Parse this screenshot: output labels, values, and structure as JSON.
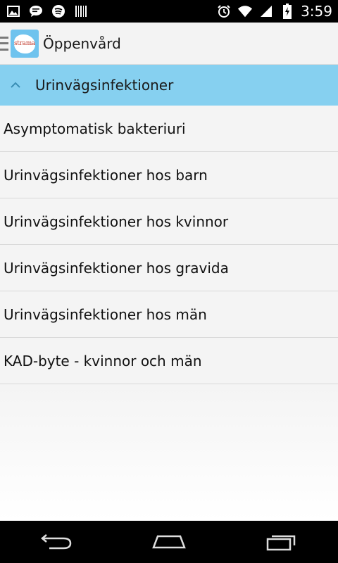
{
  "status_bar": {
    "time": "3:59",
    "left_icons": [
      "image-icon",
      "chat-icon",
      "spotify-icon",
      "barcode-icon"
    ],
    "right_icons": [
      "alarm-icon",
      "wifi-icon",
      "signal-icon",
      "battery-charging-icon"
    ]
  },
  "action_bar": {
    "logo_text": "strama",
    "title": "Öppenvård"
  },
  "group": {
    "label": "Urinvägsinfektioner",
    "expanded": true
  },
  "items": [
    {
      "label": "Asymptomatisk bakteriuri"
    },
    {
      "label": "Urinvägsinfektioner hos barn"
    },
    {
      "label": "Urinvägsinfektioner hos kvinnor"
    },
    {
      "label": "Urinvägsinfektioner hos gravida"
    },
    {
      "label": "Urinvägsinfektioner hos män"
    },
    {
      "label": "KAD-byte - kvinnor och män"
    }
  ],
  "navigation": [
    "back-icon",
    "home-icon",
    "recents-icon"
  ],
  "colors": {
    "group_header": "#86d0f0",
    "logo": "#6fc3ee",
    "status_bar": "#000000"
  }
}
